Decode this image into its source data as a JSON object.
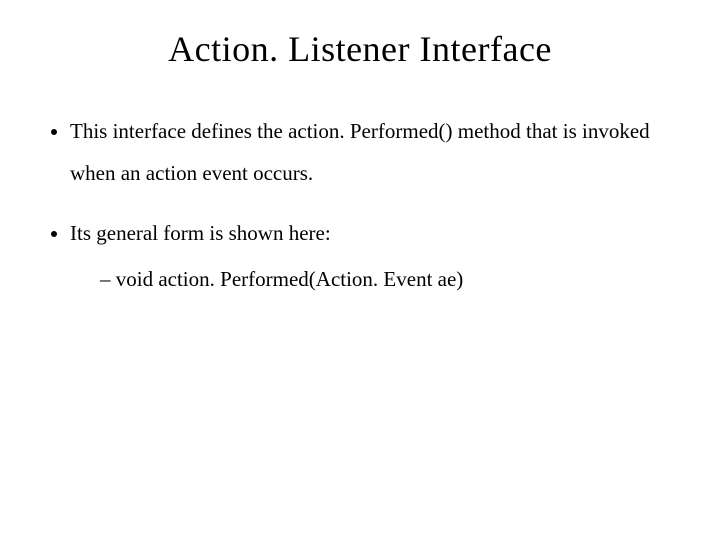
{
  "title": "Action. Listener Interface",
  "bullets": [
    "This interface defines the action. Performed() method that is invoked when an action event occurs.",
    "Its general form is shown here:"
  ],
  "subbullets": [
    "void action. Performed(Action. Event ae)"
  ]
}
